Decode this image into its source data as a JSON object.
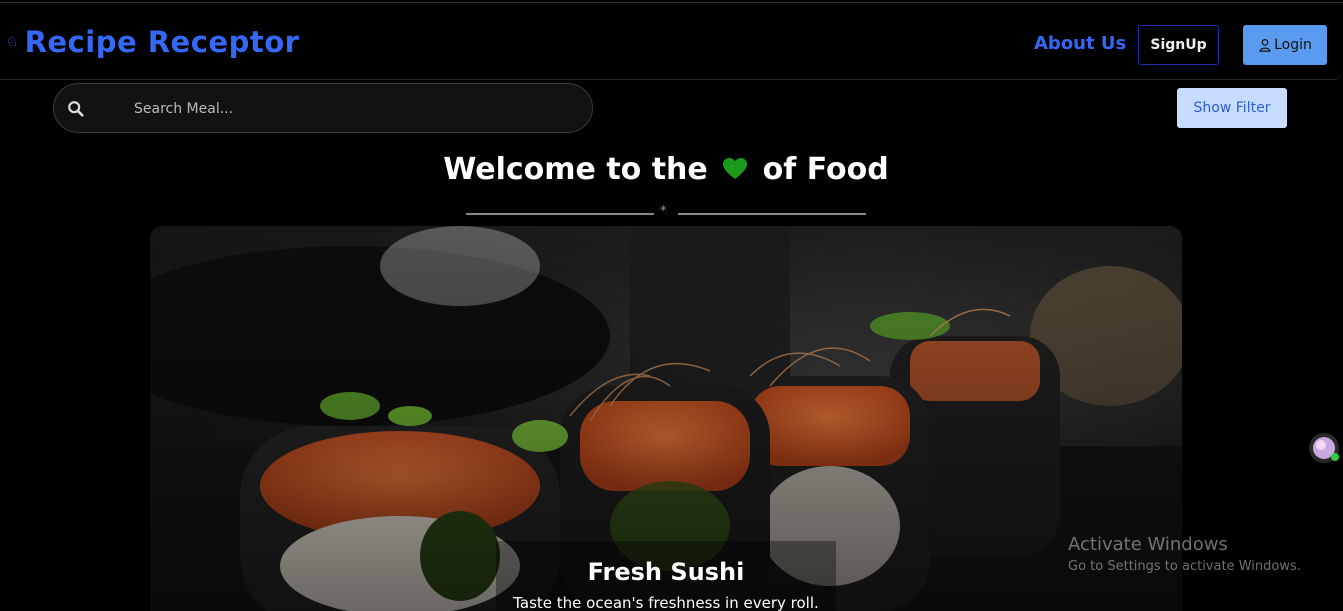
{
  "nav": {
    "brand": "Recipe Receptor",
    "brand_icon": "chef-hat-icon",
    "about": "About Us",
    "signup": "SignUp",
    "login": "Login"
  },
  "search": {
    "placeholder": "Search Meal...",
    "value": ""
  },
  "filter": {
    "label": "Show Filter"
  },
  "welcome": {
    "before": "Welcome to the",
    "after": "of Food"
  },
  "hero": {
    "title": "Fresh Sushi",
    "subtitle": "Taste the ocean's freshness in every roll."
  },
  "watermark": {
    "line1": "Activate Windows",
    "line2": "Go to Settings to activate Windows."
  },
  "colors": {
    "brand": "#3569f5",
    "login_bg": "#5a9bf0",
    "filter_bg": "#c7dcff",
    "heart": "#1a9c1a"
  }
}
